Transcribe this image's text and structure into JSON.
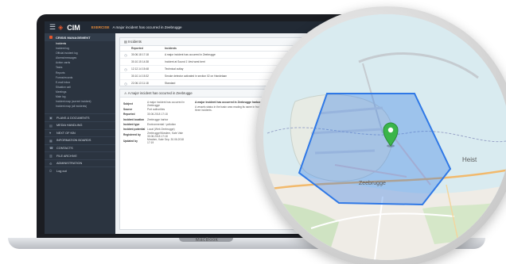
{
  "app": {
    "logo": "CIM",
    "exercise_label": "EXERCISE",
    "exercise_title": "A major incident has occurred in Zeebrugge",
    "device_brand": "MacBook"
  },
  "sidebar": {
    "section_title": "CRISIS MANAGEMENT",
    "items": [
      {
        "label": "Incidents",
        "active": true
      },
      {
        "label": "Incident log"
      },
      {
        "label": "Official incident log"
      },
      {
        "label": "Alarms/messages"
      },
      {
        "label": "Action cards"
      },
      {
        "label": "Tasks"
      },
      {
        "label": "Reports"
      },
      {
        "label": "Forms/records"
      },
      {
        "label": "E-mail inbox"
      },
      {
        "label": "Situation call"
      },
      {
        "label": "Meetings"
      },
      {
        "label": "Main log"
      },
      {
        "label": "Incident map (current incident)"
      },
      {
        "label": "Incident map (all incidents)"
      }
    ],
    "sections": [
      {
        "label": "PLANS & DOCUMENTS"
      },
      {
        "label": "MEDIA HANDLING"
      },
      {
        "label": "NEXT OF KIN"
      },
      {
        "label": "INFORMATION BOARDS"
      },
      {
        "label": "CONTACTS"
      },
      {
        "label": "FILE ARCHIVE"
      },
      {
        "label": "ADMINISTRATION"
      },
      {
        "label": "Log out"
      }
    ]
  },
  "incidents_panel": {
    "title": "Incidents",
    "columns": [
      "Reported",
      "Incidents"
    ],
    "rows": [
      {
        "date": "30.06.18 17:18",
        "text": "A major incident has occurred in Zeebrugge"
      },
      {
        "date": "30.10.15 14:38",
        "text": "Incident at Sound 1 Vest west berri"
      },
      {
        "date": "12.12.14 15:48",
        "text": "Technical outlay"
      },
      {
        "date": "30.10.14 15:32",
        "text": "Smoke detector activated in section 02 on Handelaan"
      },
      {
        "date": "22.06.13 11:18",
        "text": "Standard"
      }
    ]
  },
  "detail_panel": {
    "title": "A major incident has occurred in Zeebrugge",
    "fields": [
      {
        "key": "Subject",
        "value": "A major incident has occurred in Zeebrugge"
      },
      {
        "key": "Source",
        "value": "Port authorities"
      },
      {
        "key": "Reported",
        "value": "30.06.2018 17:18"
      },
      {
        "key": "Incident location",
        "value": "Zeebrugge harbor"
      },
      {
        "key": "Incident type",
        "value": "Environmental / pollution"
      },
      {
        "key": "Incident potential",
        "value": "Local (Web Zeebrugge)"
      },
      {
        "key": "Registered by",
        "value": "Zeebrugge/Mowlem, Kate Vale 30.06.2018 17:18"
      },
      {
        "key": "Updated by",
        "value": "Mowlem, Kate Sep. 30.06.2018 17:19"
      }
    ],
    "description_title": "A major incident has occurred in Zeebrugge harbor - Initial Notification",
    "description": "A vessels status in the basin area reading its name in front of the Oil Services is sinking, with the oil spill tanks started leaking three incidents."
  },
  "map": {
    "place_labels": [
      "Zeebrugge",
      "Heist"
    ],
    "marker": "location-pin",
    "colors": {
      "polygon": "#2f78e6",
      "marker": "#3bb54a",
      "water": "#d9ebf0",
      "land": "#efece6"
    }
  }
}
